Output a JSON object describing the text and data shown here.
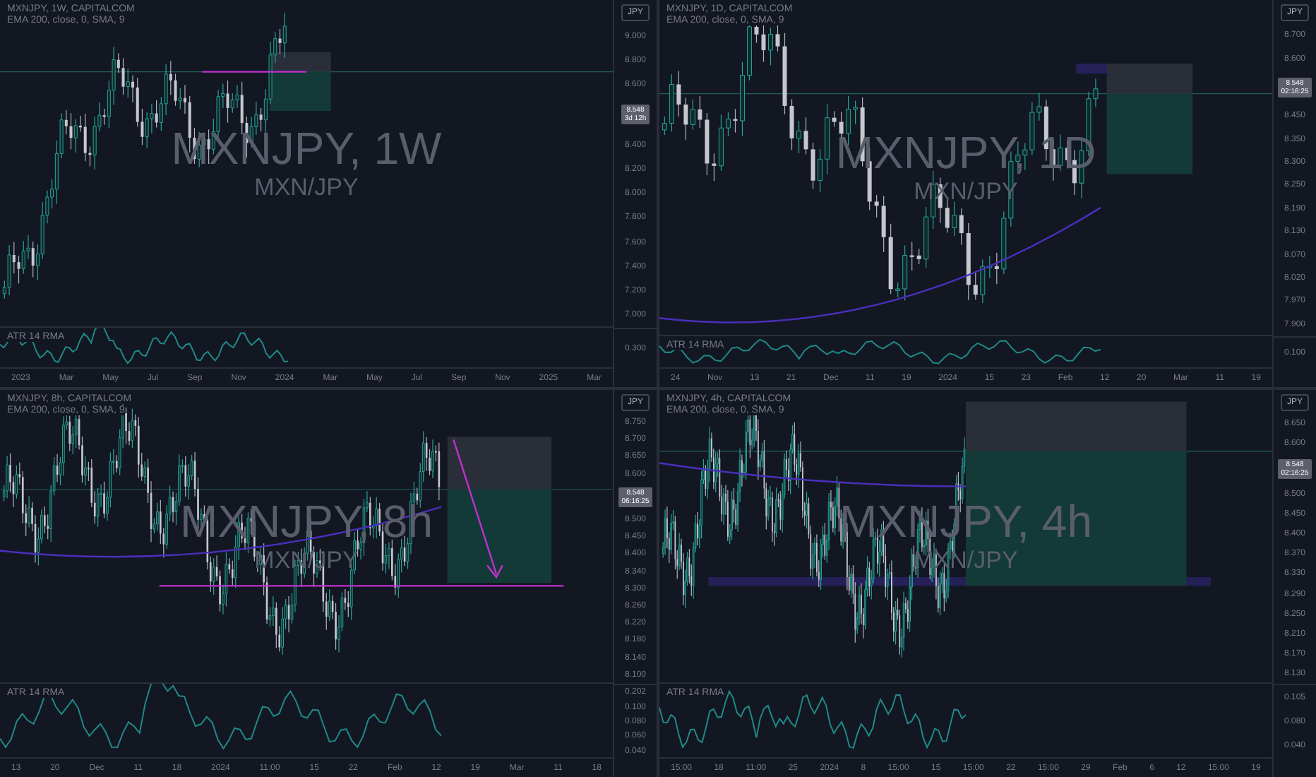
{
  "panels": [
    {
      "symbol_line": "MXNJPY, 1W, CAPITALCOM",
      "indicator_line": "EMA 200, close, 0, SMA, 9",
      "currency_button": "JPY",
      "watermark_title": "MXNJPY, 1W",
      "watermark_subtitle": "MXN/JPY",
      "price_badge": {
        "price": "8.548",
        "countdown": "3d 12h"
      },
      "price_labels": [
        "9.000",
        "8.800",
        "8.600",
        "8.400",
        "8.200",
        "8.000",
        "7.800",
        "7.600",
        "7.400",
        "7.200",
        "7.000"
      ],
      "atr_label": "ATR 14 RMA",
      "atr_labels": [
        "0.300"
      ],
      "time_labels": [
        "2023",
        "Mar",
        "May",
        "Jul",
        "Sep",
        "Nov",
        "2024",
        "Mar",
        "May",
        "Jul",
        "Sep",
        "Nov",
        "2025",
        "Mar"
      ]
    },
    {
      "symbol_line": "MXNJPY, 1D, CAPITALCOM",
      "indicator_line": "EMA 200, close, 0, SMA, 9",
      "currency_button": "JPY",
      "watermark_title": "MXNJPY, 1D",
      "watermark_subtitle": "MXN/JPY",
      "price_badge": {
        "price": "8.548",
        "countdown": "02:16:25"
      },
      "price_labels": [
        "8.700",
        "8.600",
        "8.450",
        "8.350",
        "8.300",
        "8.250",
        "8.190",
        "8.130",
        "8.070",
        "8.020",
        "7.970",
        "7.900"
      ],
      "atr_label": "ATR 14 RMA",
      "atr_labels": [
        "0.100"
      ],
      "time_labels": [
        "24",
        "Nov",
        "13",
        "21",
        "Dec",
        "11",
        "19",
        "2024",
        "15",
        "23",
        "Feb",
        "12",
        "20",
        "Mar",
        "11",
        "19"
      ]
    },
    {
      "symbol_line": "MXNJPY, 8h, CAPITALCOM",
      "indicator_line": "EMA 200, close, 0, SMA, 9",
      "currency_button": "JPY",
      "watermark_title": "MXNJPY, 8h",
      "watermark_subtitle": "MXN/JPY",
      "price_badge": {
        "price": "8.548",
        "countdown": "06:16:25"
      },
      "price_labels": [
        "8.750",
        "8.700",
        "8.650",
        "8.600",
        "8.500",
        "8.450",
        "8.400",
        "8.340",
        "8.300",
        "8.260",
        "8.220",
        "8.180",
        "8.140",
        "8.100"
      ],
      "atr_label": "ATR 14 RMA",
      "atr_labels": [
        "0.202",
        "0.100",
        "0.080",
        "0.060",
        "0.040"
      ],
      "time_labels": [
        "13",
        "20",
        "Dec",
        "11",
        "18",
        "2024",
        "11:00",
        "15",
        "22",
        "Feb",
        "12",
        "19",
        "Mar",
        "11",
        "18"
      ]
    },
    {
      "symbol_line": "MXNJPY, 4h, CAPITALCOM",
      "indicator_line": "EMA 200, close, 0, SMA, 9",
      "currency_button": "JPY",
      "watermark_title": "MXNJPY, 4h",
      "watermark_subtitle": "MXN/JPY",
      "price_badge": {
        "price": "8.548",
        "countdown": "02:16:25"
      },
      "price_labels": [
        "8.650",
        "8.600",
        "8.500",
        "8.450",
        "8.400",
        "8.370",
        "8.330",
        "8.290",
        "8.250",
        "8.210",
        "8.170",
        "8.130"
      ],
      "atr_label": "ATR 14 RMA",
      "atr_labels": [
        "0.105",
        "0.080",
        "0.040"
      ],
      "time_labels": [
        "15:00",
        "18",
        "11:00",
        "25",
        "2024",
        "8",
        "15:00",
        "15",
        "15:00",
        "22",
        "15:00",
        "29",
        "Feb",
        "6",
        "12",
        "15:00",
        "19"
      ]
    }
  ]
}
